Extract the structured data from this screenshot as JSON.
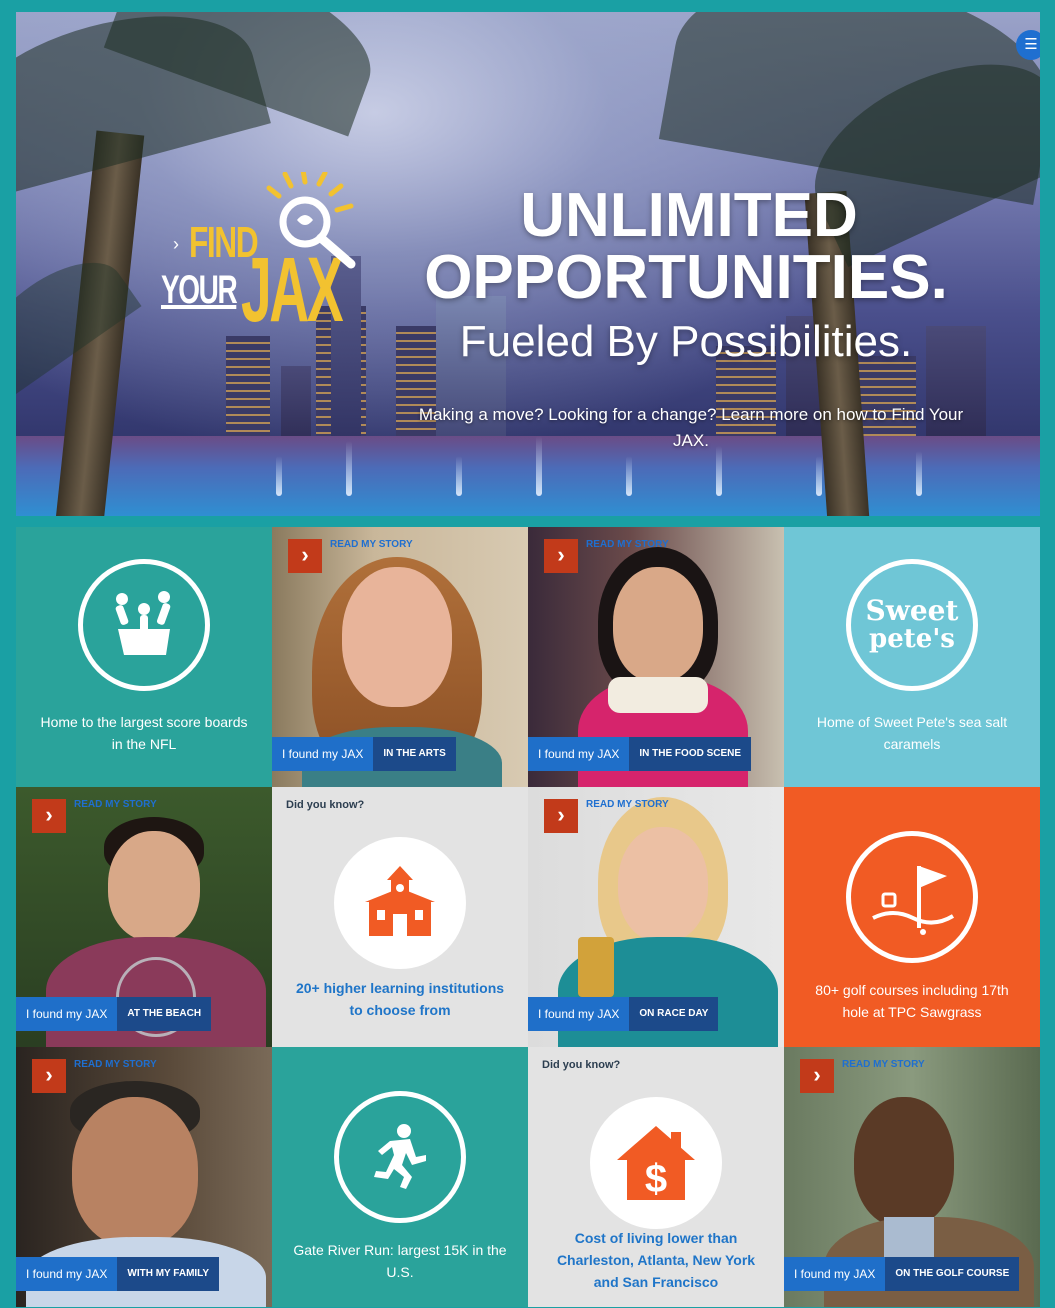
{
  "hero": {
    "menu_icon": "hamburger-icon",
    "logo": {
      "arrow": "›",
      "find": "FIND",
      "your": "YOUR",
      "jax": "JAX"
    },
    "headline_line1": "UNLIMITED",
    "headline_line2": "OPPORTUNITIES.",
    "headline_line3": "Fueled By Possibilities.",
    "subtext": "Making a move? Looking for a change? Learn more on how to Find Your JAX."
  },
  "tiles": {
    "nfl": {
      "icon": "cheering-fans-icon",
      "text": "Home to the largest score boards in the NFL"
    },
    "arts": {
      "read": "READ MY STORY",
      "found": "I found my JAX",
      "category": "IN THE ARTS"
    },
    "food": {
      "read": "READ MY STORY",
      "found": "I found my JAX",
      "category": "IN THE FOOD SCENE"
    },
    "sweet": {
      "logo_line1": "Sweet",
      "logo_line2": "pete's",
      "text": "Home of Sweet Pete's sea salt caramels"
    },
    "beach": {
      "read": "READ MY STORY",
      "found": "I found my JAX",
      "category": "AT THE BEACH"
    },
    "learning": {
      "label": "Did you know?",
      "icon": "schoolhouse-icon",
      "text": "20+ higher learning institutions to choose from"
    },
    "race": {
      "read": "READ MY STORY",
      "found": "I found my JAX",
      "category": "ON RACE DAY"
    },
    "golf": {
      "icon": "golf-flag-icon",
      "text": "80+ golf courses including 17th hole at TPC Sawgrass"
    },
    "family": {
      "read": "READ MY STORY",
      "found": "I found my JAX",
      "category": "WITH MY FAMILY"
    },
    "run": {
      "icon": "runner-icon",
      "text": "Gate River Run: largest 15K in the U.S."
    },
    "cost": {
      "label": "Did you know?",
      "icon": "house-dollar-icon",
      "text": "Cost of living lower than Charleston, Atlanta, New York and San Francisco"
    },
    "golfcourse": {
      "read": "READ MY STORY",
      "found": "I found my JAX",
      "category": "ON THE GOLF COURSE"
    }
  }
}
